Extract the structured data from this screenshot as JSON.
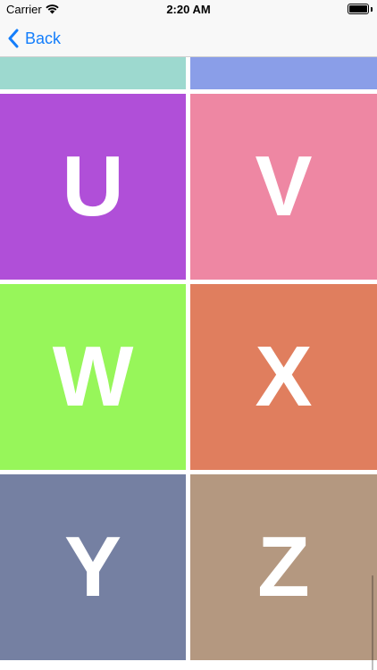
{
  "status_bar": {
    "carrier": "Carrier",
    "time": "2:20 AM"
  },
  "nav": {
    "back_label": "Back"
  },
  "tiles": [
    {
      "letter": "",
      "color": "#9dd9cf"
    },
    {
      "letter": "",
      "color": "#8a9ee8"
    },
    {
      "letter": "U",
      "color": "#b04fd8"
    },
    {
      "letter": "V",
      "color": "#ee87a3"
    },
    {
      "letter": "W",
      "color": "#97f65a"
    },
    {
      "letter": "X",
      "color": "#e07e5e"
    },
    {
      "letter": "Y",
      "color": "#7580a2"
    },
    {
      "letter": "Z",
      "color": "#b49880"
    }
  ]
}
